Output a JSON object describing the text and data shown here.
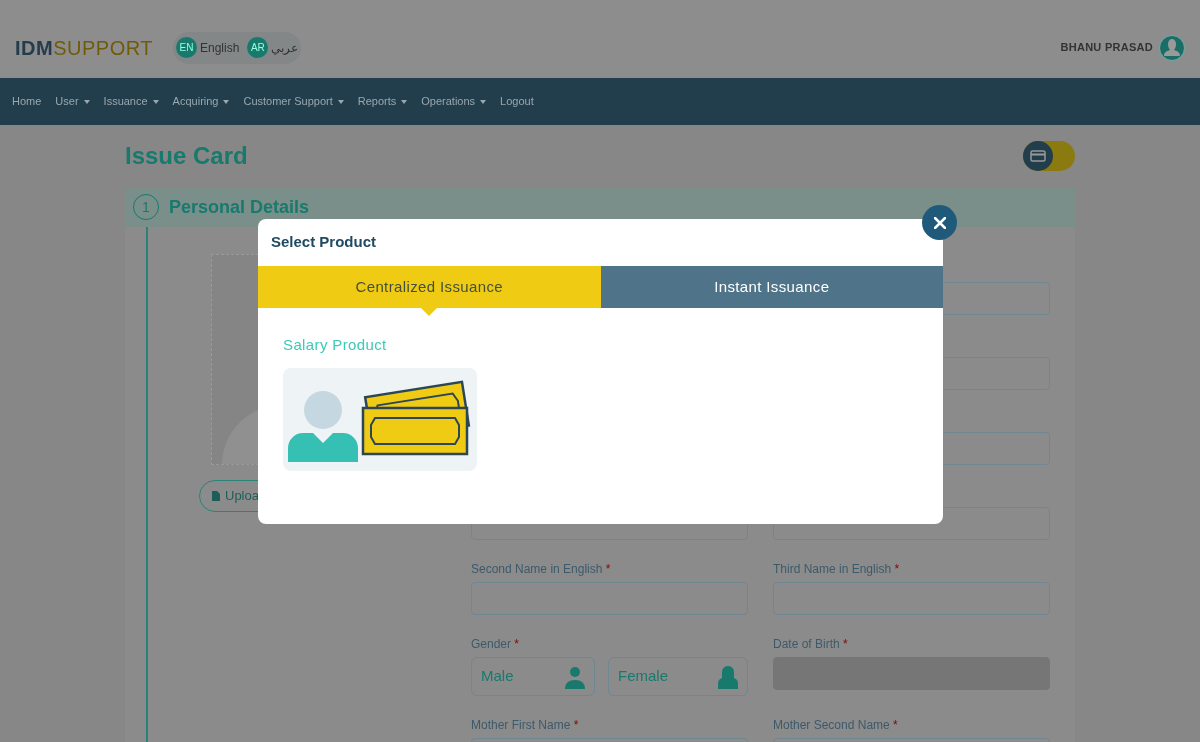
{
  "header": {
    "logo_bold": "IDM",
    "logo_light": "SUPPORT",
    "languages": [
      {
        "code": "EN",
        "label": "English"
      },
      {
        "code": "AR",
        "label": "عربي"
      }
    ],
    "user": "BHANU PRASAD"
  },
  "nav": [
    {
      "label": "Home",
      "dropdown": false
    },
    {
      "label": "User",
      "dropdown": true
    },
    {
      "label": "Issuance",
      "dropdown": true
    },
    {
      "label": "Acquiring",
      "dropdown": true
    },
    {
      "label": "Customer Support",
      "dropdown": true
    },
    {
      "label": "Reports",
      "dropdown": true
    },
    {
      "label": "Operations",
      "dropdown": true
    },
    {
      "label": "Logout",
      "dropdown": false
    }
  ],
  "page": {
    "title": "Issue Card",
    "view_toggle": {
      "on": false
    },
    "section": {
      "number": "1",
      "title": "Personal Details"
    },
    "upload_button": "Uploa",
    "rows": [
      {
        "right": {
          "kind": "text",
          "disabled": false
        }
      },
      {
        "right": {
          "kind": "text",
          "disabled": false
        }
      },
      {
        "right": {
          "kind": "text",
          "disabled": false
        }
      },
      {
        "left": {
          "kind": "text",
          "disabled": false
        },
        "right": {
          "kind": "text",
          "disabled": false
        }
      },
      {
        "left": {
          "kind": "text",
          "label": "Second Name in English",
          "required_mark": "*",
          "disabled": false
        },
        "right": {
          "kind": "text",
          "label": "Third Name in English",
          "required_mark": "*",
          "disabled": false
        }
      },
      {
        "left": {
          "kind": "gender",
          "label": "Gender",
          "required_mark": "*",
          "options": [
            {
              "label": "Male"
            },
            {
              "label": "Female"
            }
          ]
        },
        "right": {
          "kind": "text",
          "label": "Date of Birth",
          "required_mark": "*",
          "disabled": true
        }
      },
      {
        "left": {
          "kind": "text",
          "label": "Mother First Name",
          "required_mark": "*",
          "disabled": false
        },
        "right": {
          "kind": "text",
          "label": "Mother Second Name",
          "required_mark": "*",
          "disabled": false
        }
      }
    ]
  },
  "modal": {
    "title": "Select Product",
    "tabs": [
      {
        "label": "Centralized Issuance",
        "selected": true
      },
      {
        "label": "Instant Issuance",
        "selected": false
      }
    ],
    "products": [
      {
        "name": "Salary Product"
      }
    ]
  }
}
